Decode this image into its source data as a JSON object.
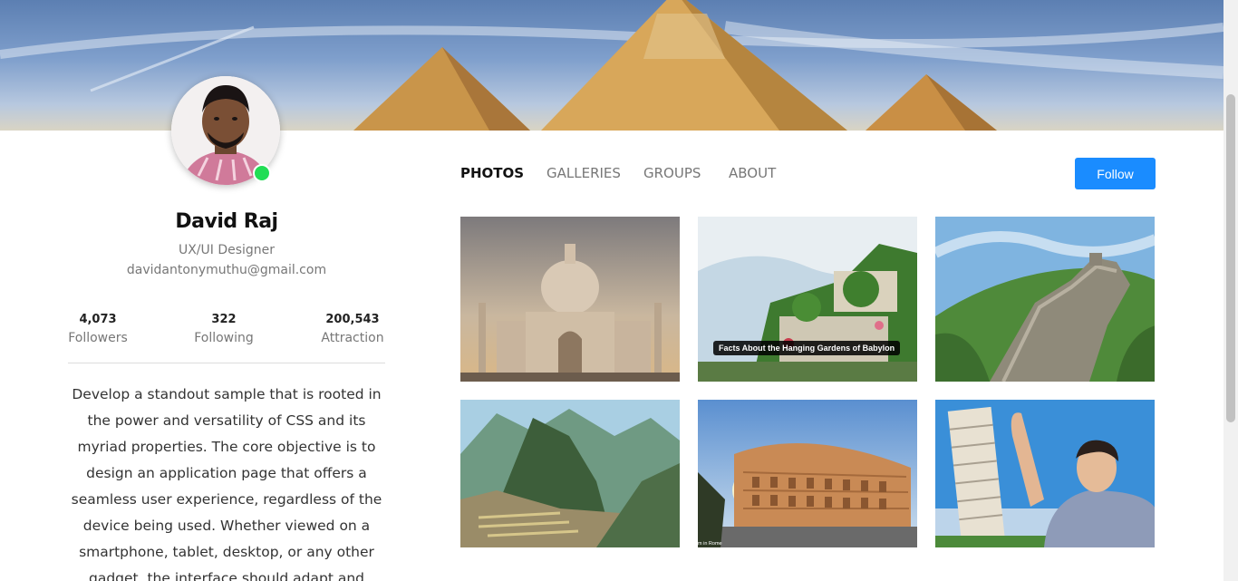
{
  "profile": {
    "name": "David Raj",
    "role": "UX/UI Designer",
    "email": "davidantonymuthu@gmail.com",
    "online": true,
    "status_color": "#22dd55"
  },
  "stats": [
    {
      "value": "4,073",
      "label": "Followers"
    },
    {
      "value": "322",
      "label": "Following"
    },
    {
      "value": "200,543",
      "label": "Attraction"
    }
  ],
  "bio": "Develop a standout sample that is rooted in the power and versatility of CSS and its myriad properties. The core objective is to design an application page that offers a seamless user experience, regardless of the device being used. Whether viewed on a smartphone, tablet, desktop, or any other gadget, the interface should adapt and",
  "nav": {
    "tabs": [
      {
        "label": "PHOTOS",
        "active": true
      },
      {
        "label": "GALLERIES",
        "active": false
      },
      {
        "label": "GROUPS",
        "active": false
      },
      {
        "label": "ABOUT",
        "active": false
      }
    ]
  },
  "follow_button": {
    "label": "Follow",
    "color": "#1a8cff"
  },
  "photos": [
    {
      "subject": "taj-mahal",
      "caption": ""
    },
    {
      "subject": "hanging-gardens",
      "caption": "Facts About the Hanging Gardens of Babylon"
    },
    {
      "subject": "great-wall",
      "caption": ""
    },
    {
      "subject": "machu-picchu",
      "caption": ""
    },
    {
      "subject": "colosseum",
      "caption": "m in Rome"
    },
    {
      "subject": "leaning-tower-pisa",
      "caption": ""
    }
  ]
}
